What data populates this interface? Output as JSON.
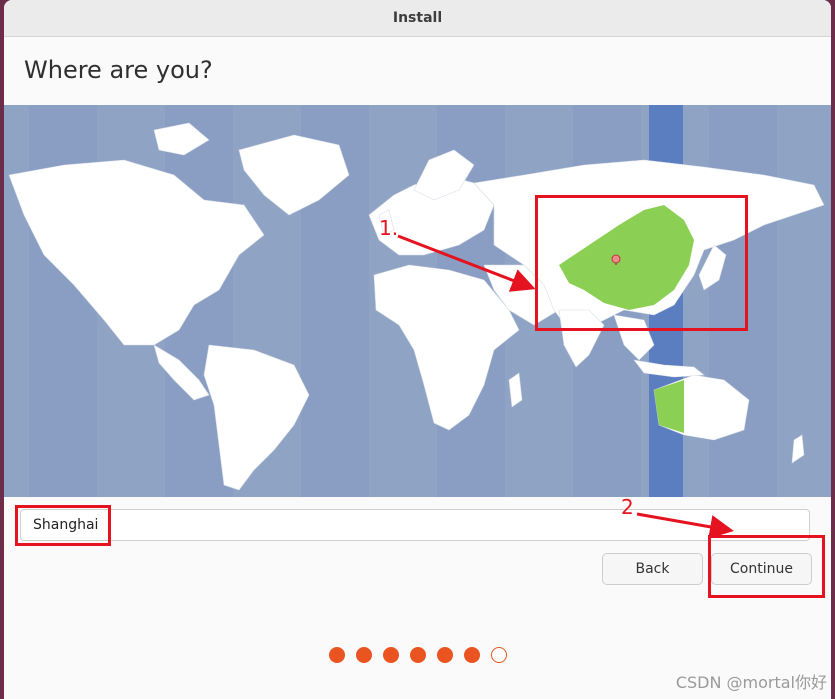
{
  "window": {
    "title": "Install"
  },
  "page": {
    "heading": "Where are you?"
  },
  "timezone": {
    "value": "Shanghai"
  },
  "buttons": {
    "back": "Back",
    "continue": "Continue"
  },
  "progress": {
    "total_steps": 7,
    "completed_steps": 6
  },
  "annotations": {
    "label_1": "1.",
    "label_2": "2"
  },
  "watermark": "CSDN @mortal你好",
  "colors": {
    "ocean": "#8fa3c5",
    "land": "#ffffff",
    "selected_tz_band": "#5b7ec0",
    "selected_country": "#8ccf55",
    "accent": "#e95420",
    "annotation": "#e4131f"
  }
}
